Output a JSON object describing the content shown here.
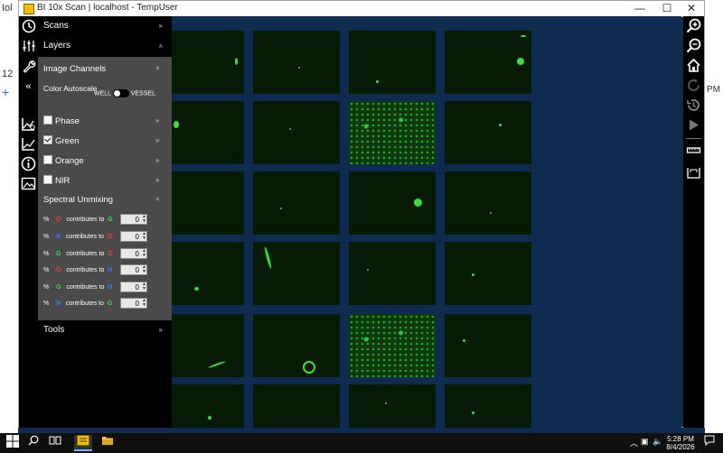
{
  "window": {
    "title": "BI 10x Scan | localhost - TempUser",
    "minimize": "—",
    "maximize": "☐",
    "close": "✕"
  },
  "background_app": {
    "left_fragments": [
      "Iol",
      "12",
      "+"
    ],
    "right_fragments": [
      "PM"
    ]
  },
  "panel": {
    "scans_label": "Scans",
    "layers_label": "Layers",
    "image_channels_label": "Image Channels",
    "color_autoscale_label": "Color Autoscale",
    "toggle_left": "WELL",
    "toggle_right": "VESSEL",
    "channels": [
      {
        "label": "Phase",
        "checked": false
      },
      {
        "label": "Green",
        "checked": true
      },
      {
        "label": "Orange",
        "checked": false
      },
      {
        "label": "NIR",
        "checked": false
      }
    ],
    "spectral_unmixing_label": "Spectral Unmixing",
    "unmixing_rows": [
      {
        "from": "O",
        "from_color": "#ff3b3b",
        "to": "G",
        "to_color": "#3adf3a",
        "value": "0"
      },
      {
        "from": "N",
        "from_color": "#3a7bff",
        "to": "O",
        "to_color": "#ff3b3b",
        "value": "0"
      },
      {
        "from": "G",
        "from_color": "#3adf3a",
        "to": "O",
        "to_color": "#ff3b3b",
        "value": "0"
      },
      {
        "from": "O",
        "from_color": "#ff3b3b",
        "to": "N",
        "to_color": "#3a7bff",
        "value": "0"
      },
      {
        "from": "G",
        "from_color": "#3adf3a",
        "to": "N",
        "to_color": "#3a7bff",
        "value": "0"
      },
      {
        "from": "N",
        "from_color": "#3a7bff",
        "to": "G",
        "to_color": "#3adf3a",
        "value": "0"
      }
    ],
    "percent_sign": "%",
    "contributes_to": "contributes to",
    "tools_label": "Tools"
  },
  "taskbar": {
    "time": "5:28 PM",
    "date": "8/4/2026"
  },
  "icons": {
    "left_toolbar": [
      "clock-icon",
      "sliders-icon",
      "wrench-icon",
      "collapse-icon",
      "graph-settings-icon",
      "graph-icon",
      "info-icon",
      "image-icon"
    ],
    "right_toolbar": [
      "zoom-in-icon",
      "zoom-out-icon",
      "home-icon",
      "refresh-icon",
      "history-icon",
      "play-icon",
      "ruler-icon",
      "measure-icon"
    ]
  },
  "colors": {
    "panel_gray": "#4a4a4a",
    "canvas_bg": "#0f2b4f",
    "fluorescence": "#3adf3a"
  }
}
